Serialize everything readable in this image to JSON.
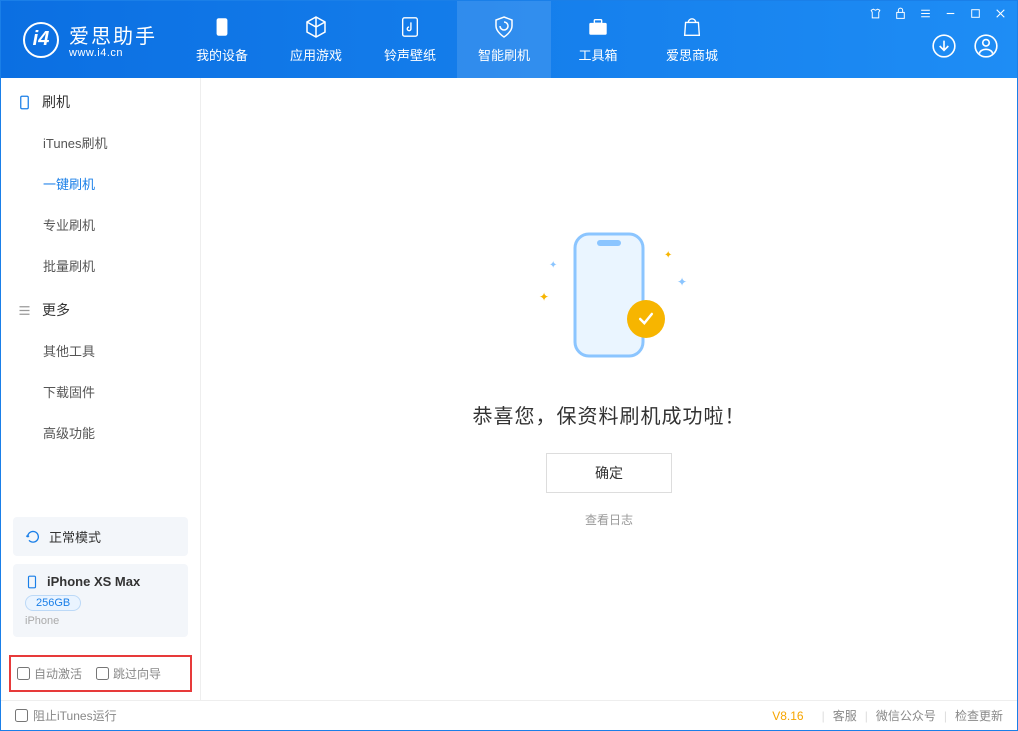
{
  "app": {
    "name": "爱思助手",
    "url": "www.i4.cn"
  },
  "nav": {
    "items": [
      {
        "label": "我的设备"
      },
      {
        "label": "应用游戏"
      },
      {
        "label": "铃声壁纸"
      },
      {
        "label": "智能刷机"
      },
      {
        "label": "工具箱"
      },
      {
        "label": "爱思商城"
      }
    ]
  },
  "sidebar": {
    "section1": {
      "title": "刷机",
      "items": [
        {
          "label": "iTunes刷机"
        },
        {
          "label": "一键刷机"
        },
        {
          "label": "专业刷机"
        },
        {
          "label": "批量刷机"
        }
      ]
    },
    "section2": {
      "title": "更多",
      "items": [
        {
          "label": "其他工具"
        },
        {
          "label": "下载固件"
        },
        {
          "label": "高级功能"
        }
      ]
    },
    "status": {
      "label": "正常模式"
    },
    "device": {
      "name": "iPhone XS Max",
      "storage": "256GB",
      "type": "iPhone"
    },
    "checkboxes": {
      "auto_activate": "自动激活",
      "skip_guide": "跳过向导"
    }
  },
  "main": {
    "success_text": "恭喜您，保资料刷机成功啦！",
    "ok_button": "确定",
    "view_log": "查看日志"
  },
  "footer": {
    "block_itunes": "阻止iTunes运行",
    "version": "V8.16",
    "links": {
      "support": "客服",
      "wechat": "微信公众号",
      "update": "检查更新"
    }
  }
}
